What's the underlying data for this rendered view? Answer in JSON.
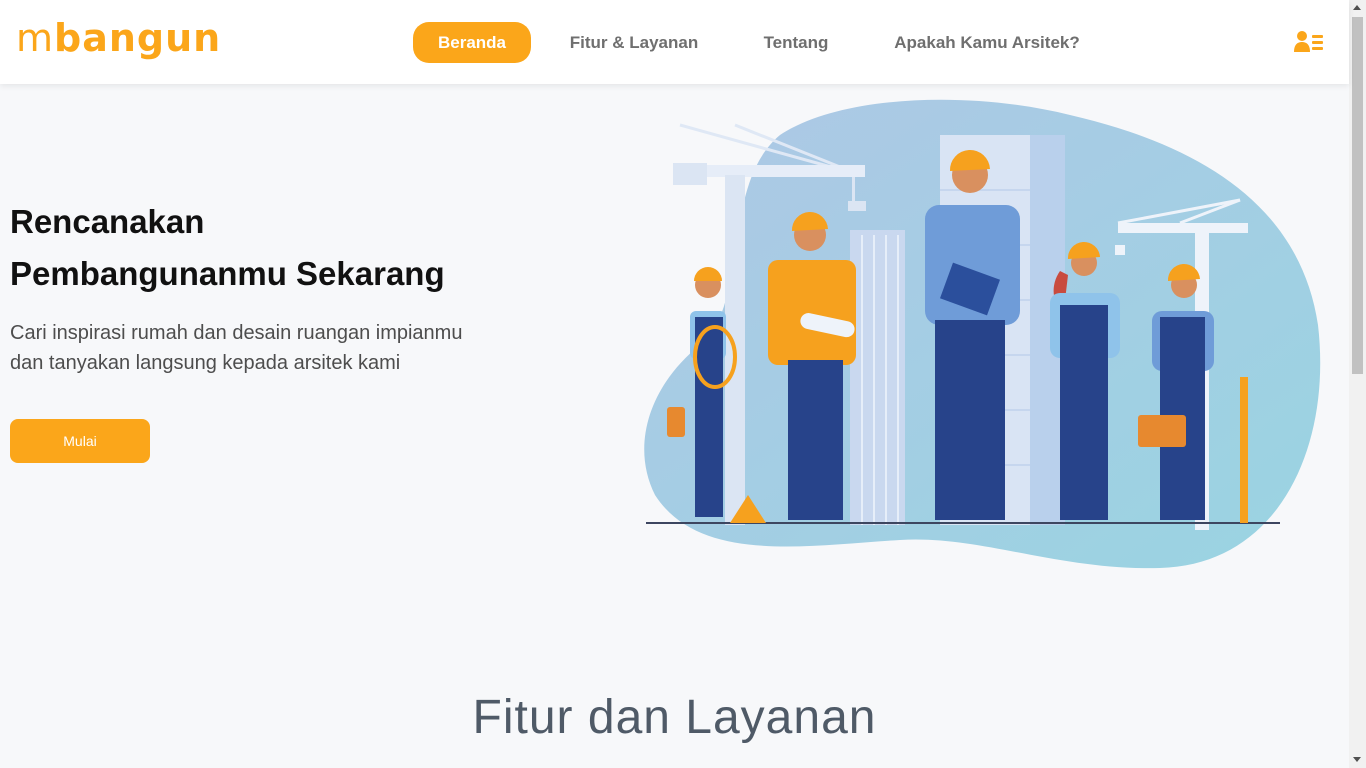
{
  "brand": {
    "logo_prefix": "m",
    "logo_suffix": "bangun",
    "accent_color": "#fba61a"
  },
  "nav": {
    "items": [
      {
        "label": "Beranda",
        "active": true
      },
      {
        "label": "Fitur & Layanan",
        "active": false
      },
      {
        "label": "Tentang",
        "active": false
      },
      {
        "label": "Apakah Kamu Arsitek?",
        "active": false
      }
    ],
    "user_icon": "user-list-icon"
  },
  "hero": {
    "title_line1": "Rencanakan",
    "title_line2": "Pembangunanmu Sekarang",
    "subtitle_line1": "Cari inspirasi rumah dan desain ruangan impianmu",
    "subtitle_line2": "dan tanyakan langsung kepada arsitek kami",
    "cta_label": "Mulai",
    "illustration": "construction-workers-illustration"
  },
  "features": {
    "title": "Fitur dan Layanan"
  }
}
